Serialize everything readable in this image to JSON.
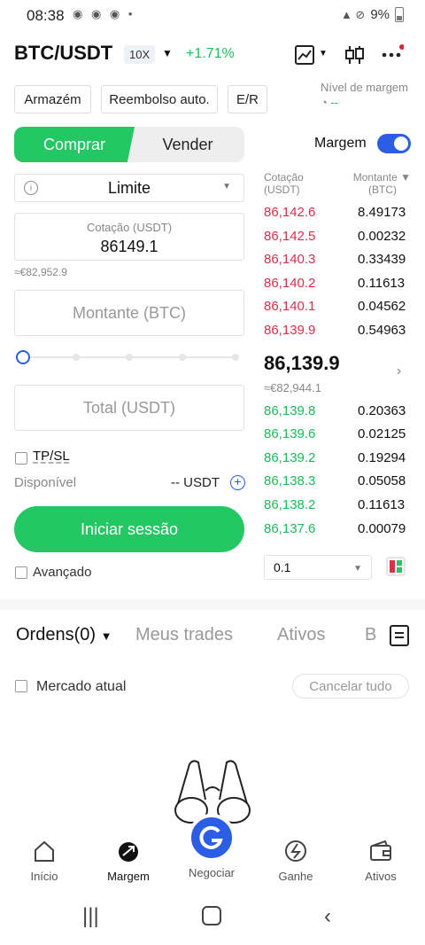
{
  "status": {
    "time": "08:38",
    "icons": "◉ ◉ ◉ •",
    "battery": "9%"
  },
  "header": {
    "pair": "BTC/USDT",
    "leverage": "10X",
    "change": "+1.71%"
  },
  "pills": {
    "warehouse": "Armazém",
    "auto_repay": "Reembolso auto.",
    "er": "E/R"
  },
  "margin_level": {
    "label": "Nível de margem",
    "value": "--"
  },
  "trade": {
    "buy": "Comprar",
    "sell": "Vender",
    "margin_label": "Margem",
    "order_type": "Limite",
    "price_label": "Cotação (USDT)",
    "price_value": "86149.1",
    "price_eur": "≈€82,952.9",
    "amount_placeholder": "Montante (BTC)",
    "total_placeholder": "Total (USDT)",
    "tpsl": "TP/SL",
    "available_label": "Disponível",
    "available_value": "-- USDT",
    "login": "Iniciar sessão",
    "advanced": "Avançado"
  },
  "orderbook": {
    "price_header": "Cotação",
    "price_unit": "(USDT)",
    "amount_header": "Montante ▼",
    "amount_unit": "(BTC)",
    "asks": [
      {
        "p": "86,142.6",
        "q": "8.49173"
      },
      {
        "p": "86,142.5",
        "q": "0.00232"
      },
      {
        "p": "86,140.3",
        "q": "0.33439"
      },
      {
        "p": "86,140.2",
        "q": "0.11613"
      },
      {
        "p": "86,140.1",
        "q": "0.04562"
      },
      {
        "p": "86,139.9",
        "q": "0.54963"
      }
    ],
    "mid_price": "86,139.9",
    "mid_eur": "≈€82,944.1",
    "bids": [
      {
        "p": "86,139.8",
        "q": "0.20363"
      },
      {
        "p": "86,139.6",
        "q": "0.02125"
      },
      {
        "p": "86,139.2",
        "q": "0.19294"
      },
      {
        "p": "86,138.3",
        "q": "0.05058"
      },
      {
        "p": "86,138.2",
        "q": "0.11613"
      },
      {
        "p": "86,137.6",
        "q": "0.00079"
      }
    ],
    "precision": "0.1"
  },
  "orders": {
    "tabs": [
      "Ordens(0)",
      "Meus trades",
      "Ativos",
      "B"
    ],
    "market_now": "Mercado atual",
    "cancel_all": "Cancelar tudo"
  },
  "nav": [
    "Início",
    "Margem",
    "Negociar",
    "Ganhe",
    "Ativos"
  ],
  "colors": {
    "green": "#23c764",
    "red": "#d8304a",
    "blue": "#2c5de5"
  }
}
